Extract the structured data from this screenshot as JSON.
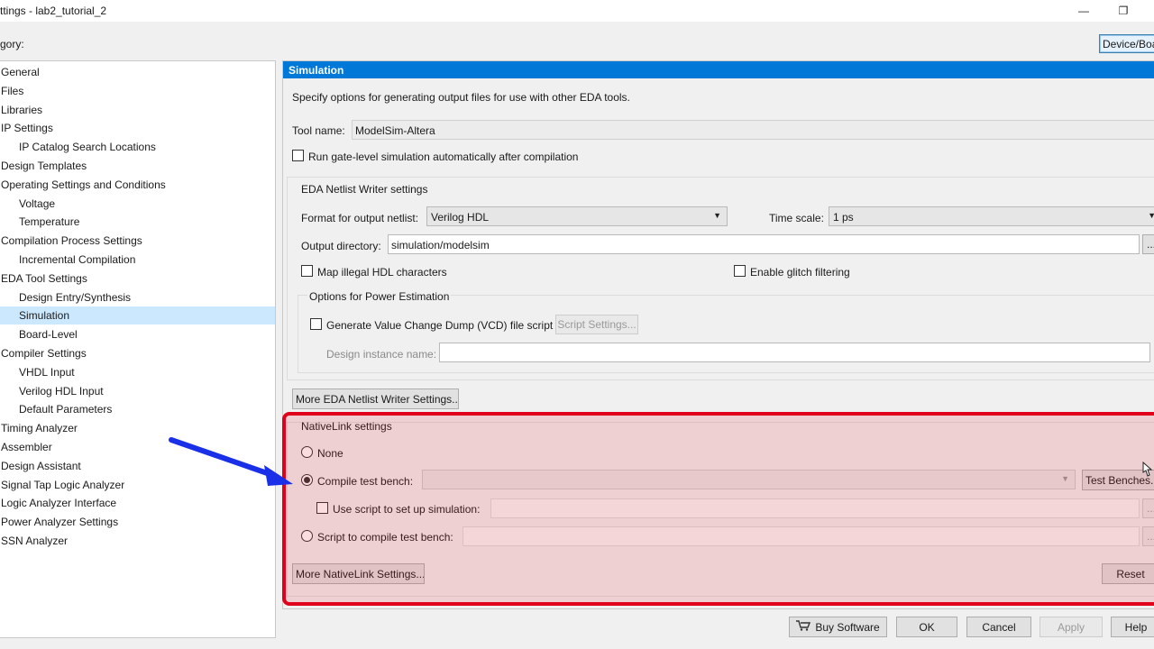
{
  "window": {
    "title": "ttings - lab2_tutorial_2",
    "minimize_glyph": "—",
    "maximize_glyph": "❐"
  },
  "category_label": "gory:",
  "device_button": "Device/Boa",
  "tree": {
    "items": [
      {
        "label": "General",
        "level": 0,
        "selected": false
      },
      {
        "label": "Files",
        "level": 0,
        "selected": false
      },
      {
        "label": "Libraries",
        "level": 0,
        "selected": false
      },
      {
        "label": "IP Settings",
        "level": 0,
        "selected": false
      },
      {
        "label": "IP Catalog Search Locations",
        "level": 1,
        "selected": false
      },
      {
        "label": "Design Templates",
        "level": 0,
        "selected": false
      },
      {
        "label": "Operating Settings and Conditions",
        "level": 0,
        "selected": false
      },
      {
        "label": "Voltage",
        "level": 1,
        "selected": false
      },
      {
        "label": "Temperature",
        "level": 1,
        "selected": false
      },
      {
        "label": "Compilation Process Settings",
        "level": 0,
        "selected": false
      },
      {
        "label": "Incremental Compilation",
        "level": 1,
        "selected": false
      },
      {
        "label": "EDA Tool Settings",
        "level": 0,
        "selected": false
      },
      {
        "label": "Design Entry/Synthesis",
        "level": 1,
        "selected": false
      },
      {
        "label": "Simulation",
        "level": 1,
        "selected": true
      },
      {
        "label": "Board-Level",
        "level": 1,
        "selected": false
      },
      {
        "label": "Compiler Settings",
        "level": 0,
        "selected": false
      },
      {
        "label": "VHDL Input",
        "level": 1,
        "selected": false
      },
      {
        "label": "Verilog HDL Input",
        "level": 1,
        "selected": false
      },
      {
        "label": "Default Parameters",
        "level": 1,
        "selected": false
      },
      {
        "label": "Timing Analyzer",
        "level": 0,
        "selected": false
      },
      {
        "label": "Assembler",
        "level": 0,
        "selected": false
      },
      {
        "label": "Design Assistant",
        "level": 0,
        "selected": false
      },
      {
        "label": "Signal Tap Logic Analyzer",
        "level": 0,
        "selected": false
      },
      {
        "label": "Logic Analyzer Interface",
        "level": 0,
        "selected": false
      },
      {
        "label": "Power Analyzer Settings",
        "level": 0,
        "selected": false
      },
      {
        "label": "SSN Analyzer",
        "level": 0,
        "selected": false
      }
    ]
  },
  "panel": {
    "header": "Simulation",
    "description": "Specify options for generating output files for use with other EDA tools.",
    "tool_name_label": "Tool name:",
    "tool_name_value": "ModelSim-Altera",
    "run_gate_level_label": "Run gate-level simulation automatically after compilation",
    "run_gate_level_checked": false,
    "netlist": {
      "group_title": "EDA Netlist Writer settings",
      "format_label": "Format for output netlist:",
      "format_value": "Verilog HDL",
      "time_scale_label": "Time scale:",
      "time_scale_value": "1 ps",
      "output_dir_label": "Output directory:",
      "output_dir_value": "simulation/modelsim",
      "browse_label": "...",
      "map_illegal_label": "Map illegal HDL characters",
      "map_illegal_checked": false,
      "glitch_label": "Enable glitch filtering",
      "glitch_checked": false
    },
    "power": {
      "group_title": "Options for Power Estimation",
      "vcd_label": "Generate Value Change Dump (VCD) file script",
      "vcd_checked": false,
      "script_settings_label": "Script Settings...",
      "design_instance_label": "Design instance name:",
      "design_instance_value": ""
    },
    "more_netlist_label": "More EDA Netlist Writer Settings...",
    "nativelink": {
      "group_title": "NativeLink settings",
      "none_label": "None",
      "compile_tb_label": "Compile test bench:",
      "compile_tb_value": "",
      "test_benches_label": "Test Benches...",
      "use_script_label": "Use script to set up simulation:",
      "use_script_value": "",
      "script_compile_label": "Script to compile test bench:",
      "script_compile_value": "",
      "browse_label": "...",
      "selected_option": "compile_tb"
    },
    "more_nativelink_label": "More NativeLink Settings...",
    "reset_label": "Reset"
  },
  "footer": {
    "buy_label": "Buy Software",
    "ok_label": "OK",
    "cancel_label": "Cancel",
    "apply_label": "Apply",
    "help_label": "Help"
  },
  "annotation": {
    "arrow_color": "#1a2fe8",
    "box_color": "#e0001b"
  }
}
